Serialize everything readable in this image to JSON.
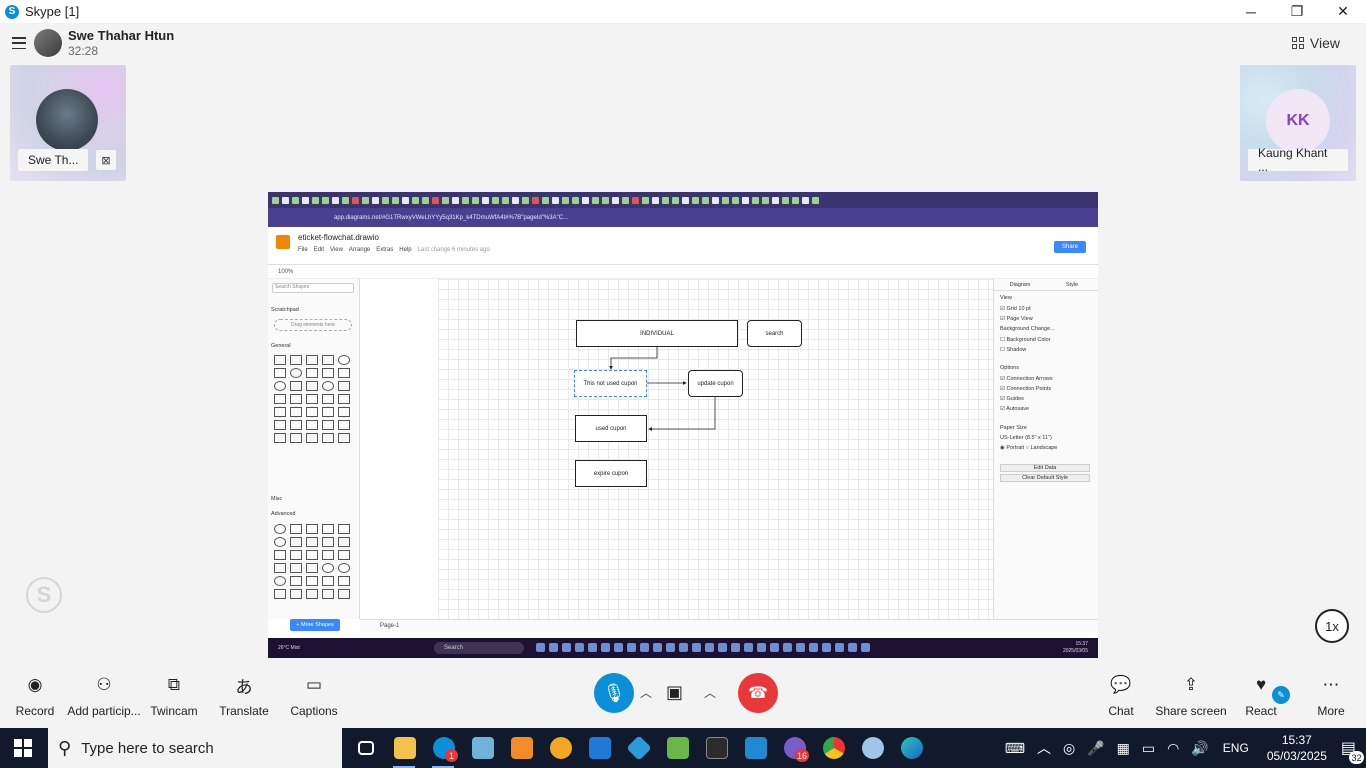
{
  "window": {
    "title": "Skype [1]",
    "app_icon": "S",
    "controls": {
      "minimize": "─",
      "maximize": "❐",
      "close": "✕"
    }
  },
  "call": {
    "caller_name": "Swe Thahar Htun",
    "timer": "32:28",
    "view_label": "View",
    "participants": [
      {
        "name": "Swe Th...",
        "muted_icon": "⊠"
      },
      {
        "name": "Kaung Khant ...",
        "initials": "KK"
      }
    ],
    "speed": "1x"
  },
  "shared_screen": {
    "url": "app.diagrams.net/#G1TRwxyVWeLhYYy5q31Kp_k4TDmuWfA4t#%7B\"pageId\"%3A\"C..."
  },
  "drawio": {
    "file_title": "eticket-flowchat.drawio",
    "menus": [
      "File",
      "Edit",
      "View",
      "Arrange",
      "Extras",
      "Help"
    ],
    "last_change": "Last change 6 minutes ago",
    "share_label": "Share",
    "zoom": "100%",
    "search_placeholder": "Search Shapes",
    "scratchpad_label": "Scratchpad",
    "drag_hint": "Drag elements here",
    "general_label": "General",
    "misc_label": "Misc",
    "advanced_label": "Advanced",
    "more_shapes": "+ More Shapes",
    "page_tab": "Page-1",
    "nodes": {
      "top": "INDIVIDUAL",
      "search": "search",
      "not_used": "This not used cupon",
      "update": "update cupon",
      "used": "used cupon",
      "expire": "expire cupon"
    },
    "right_panel": {
      "tab_diagram": "Diagram",
      "tab_style": "Style",
      "view_label": "View",
      "grid": "Grid",
      "grid_size": "10 pt",
      "page_view": "Page View",
      "background": "Background",
      "change": "Change...",
      "bg_color": "Background Color",
      "shadow": "Shadow",
      "options_label": "Options",
      "connection_arrows": "Connection Arrows",
      "connection_points": "Connection Points",
      "guides": "Guides",
      "autosave": "Autosave",
      "paper_size_label": "Paper Size",
      "paper_size": "US-Letter (8.5\" x 11\")",
      "portrait": "Portrait",
      "landscape": "Landscape",
      "edit_data": "Edit Data",
      "clear_default": "Clear Default Style"
    },
    "inner_taskbar": {
      "weather": "26°C Mist",
      "search": "Search",
      "time": "15:37",
      "date": "2025/03/05"
    }
  },
  "controls": {
    "record": "Record",
    "add_participants": "Add particip...",
    "twincam": "Twincam",
    "translate": "Translate",
    "captions": "Captions",
    "chat": "Chat",
    "share_screen": "Share screen",
    "react": "React",
    "more": "More"
  },
  "taskbar": {
    "search_placeholder": "Type here to search",
    "skype_badge": "1",
    "viber_badge": "16",
    "language": "ENG",
    "time": "15:37",
    "date": "05/03/2025",
    "notifications": "32"
  },
  "colors": {
    "skype_blue": "#0a8fd8",
    "end_call_red": "#e8383c",
    "taskbar_bg": "#101a2c",
    "drawio_orange": "#f08705",
    "drawio_blue": "#3a88fe"
  }
}
